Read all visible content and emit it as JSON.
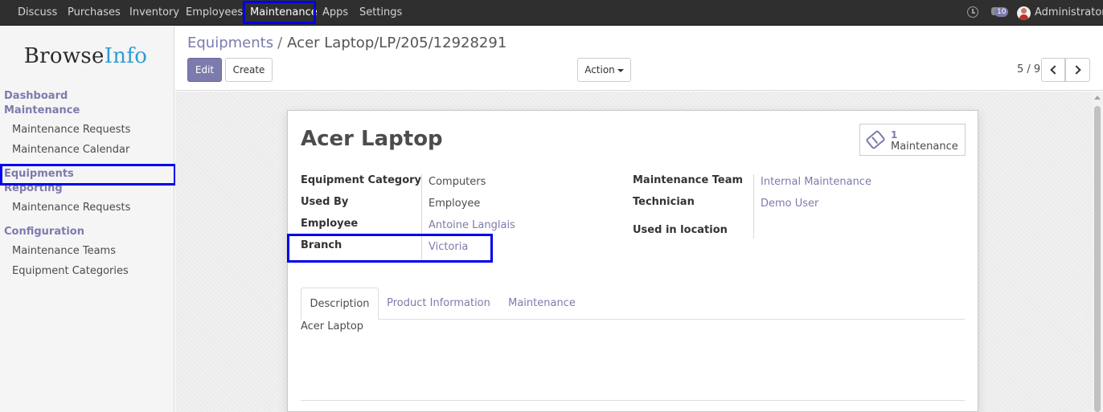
{
  "topbar": {
    "menu": [
      "Discuss",
      "Purchases",
      "Inventory",
      "Employees",
      "Maintenance",
      "Apps",
      "Settings"
    ],
    "active": "Maintenance",
    "notifications_count": "10",
    "user": "Administrator",
    "icons": [
      "clock-icon",
      "chat-icon",
      "avatar"
    ]
  },
  "sidebar": {
    "logo_part1": "Browse",
    "logo_part2": "Info",
    "sections": [
      {
        "title": "Dashboard",
        "items": []
      },
      {
        "title": "Maintenance",
        "items": [
          "Maintenance Requests",
          "Maintenance Calendar"
        ]
      },
      {
        "title": "Equipments",
        "items": []
      },
      {
        "title": "Reporting",
        "items": [
          "Maintenance Requests"
        ]
      },
      {
        "title": "Configuration",
        "items": [
          "Maintenance Teams",
          "Equipment Categories"
        ]
      }
    ]
  },
  "control": {
    "breadcrumb_parent": "Equipments",
    "breadcrumb_sep": "/",
    "breadcrumb_current": "Acer Laptop/LP/205/12928291",
    "edit_label": "Edit",
    "create_label": "Create",
    "action_label": "Action",
    "pager": "5 / 9"
  },
  "record": {
    "title": "Acer Laptop",
    "smart_button": {
      "count": "1",
      "label": "Maintenance",
      "icon": "ticket-icon"
    },
    "left_fields": [
      {
        "label": "Equipment Category",
        "value": "Computers"
      },
      {
        "label": "Used By",
        "value": "Employee"
      },
      {
        "label": "Employee",
        "value": "Antoine Langlais"
      },
      {
        "label": "Branch",
        "value": "Victoria"
      }
    ],
    "right_fields": [
      {
        "label": "Maintenance Team",
        "value": "Internal Maintenance"
      },
      {
        "label": "Technician",
        "value": "Demo User"
      },
      {
        "label": "Used in location",
        "value": ""
      }
    ],
    "tabs": [
      "Description",
      "Product Information",
      "Maintenance"
    ],
    "active_tab": "Description",
    "description": "Acer Laptop"
  },
  "colors": {
    "accent": "#7c7bad",
    "topbar": "#2f2f2f",
    "highlight": "#0000ee",
    "logo_accent": "#2e9bd6"
  }
}
